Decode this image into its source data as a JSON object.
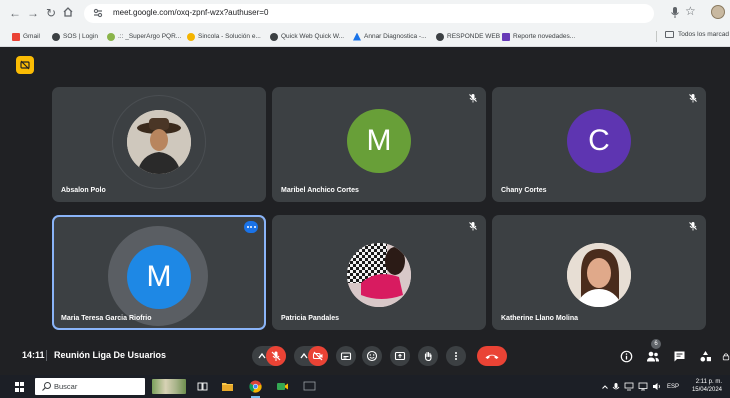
{
  "browser": {
    "url": "meet.google.com/oxq-zpnf-wzx?authuser=0",
    "bookmarks": [
      {
        "label": "Gmail",
        "color": "#ea4335"
      },
      {
        "label": "SOS | Login",
        "color": "#3c4043"
      },
      {
        "label": ".:: _SuperArgo PQR...",
        "color": "#8ab44a"
      },
      {
        "label": "Sincola - Solución e...",
        "color": "#f4b400"
      },
      {
        "label": "Quick Web Quick W...",
        "color": "#3c4043"
      },
      {
        "label": "Annar Diagnostica -...",
        "color": "#1a73e8"
      },
      {
        "label": "RESPONDE WEB",
        "color": "#3c4043"
      },
      {
        "label": "Reporte novedades...",
        "color": "#673ab7"
      }
    ],
    "bookmarks_folder": "Todos los marcad"
  },
  "participants": [
    {
      "name": "Absalon Polo",
      "avatar_type": "photo",
      "muted": false
    },
    {
      "name": "Maribel Anchico Cortes",
      "avatar_type": "initial",
      "initial": "M",
      "color": "#689f38",
      "muted": true
    },
    {
      "name": "Chany Cortes",
      "avatar_type": "initial",
      "initial": "C",
      "color": "#5e35b1",
      "muted": true
    },
    {
      "name": "Maria Teresa Garcia Riofrio",
      "avatar_type": "initial",
      "initial": "M",
      "color": "#1e88e5",
      "muted": false,
      "speaking": true
    },
    {
      "name": "Patricia Pandales",
      "avatar_type": "photo",
      "muted": true
    },
    {
      "name": "Katherine Llano Molina",
      "avatar_type": "photo",
      "muted": true
    }
  ],
  "meeting": {
    "time": "14:11",
    "separator": "|",
    "title": "Reunión Liga De Usuarios",
    "people_count": "6"
  },
  "taskbar": {
    "search_placeholder": "Buscar",
    "language": "ESP",
    "time": "2:11 p. m.",
    "date": "15/04/2024"
  },
  "colors": {
    "meet_bg": "#202124",
    "tile_bg": "#3c4043",
    "danger": "#ea4335",
    "active_outline": "#8ab4f8"
  }
}
